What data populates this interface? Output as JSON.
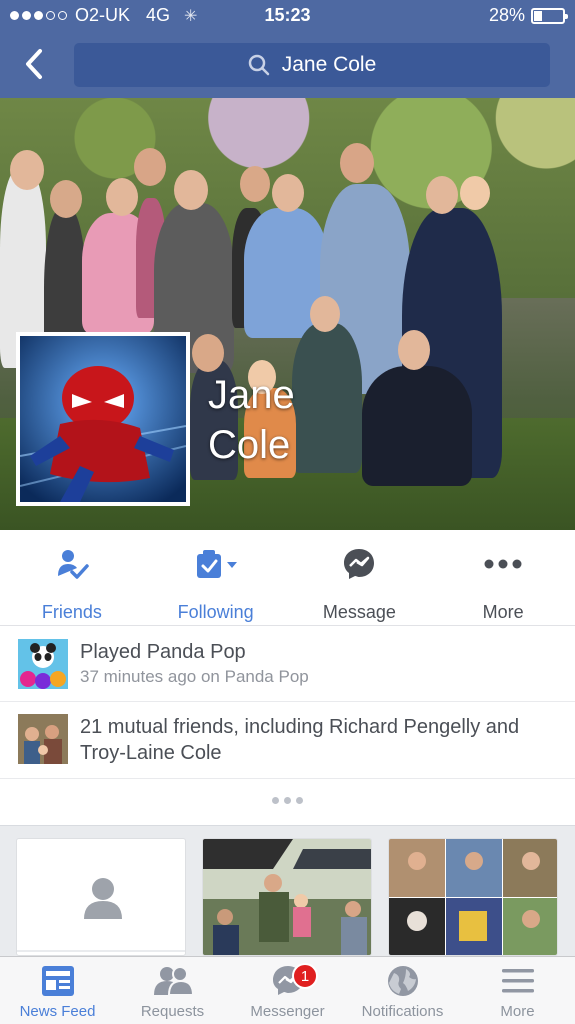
{
  "status_bar": {
    "carrier": "O2-UK",
    "network": "4G",
    "time": "15:23",
    "battery_percent": "28%",
    "battery_level": 0.28,
    "signal_bars": 3
  },
  "header": {
    "search_text": "Jane Cole"
  },
  "profile": {
    "name_line1": "Jane",
    "name_line2": "Cole"
  },
  "actions": [
    {
      "label": "Friends",
      "icon": "friends-check-icon",
      "color": "#4a7fd8"
    },
    {
      "label": "Following",
      "icon": "following-icon",
      "color": "#4a7fd8"
    },
    {
      "label": "Message",
      "icon": "messenger-icon",
      "color": "#4b4f56"
    },
    {
      "label": "More",
      "icon": "more-dots-icon",
      "color": "#4b4f56"
    }
  ],
  "info": {
    "activity_title": "Played Panda Pop",
    "activity_sub": "37 minutes ago on Panda Pop",
    "mutual_friends": "21 mutual friends, including Richard Pengelly and Troy-Laine Cole"
  },
  "tabs": [
    {
      "label": "News Feed",
      "icon": "news-feed-icon",
      "active": true
    },
    {
      "label": "Requests",
      "icon": "requests-icon"
    },
    {
      "label": "Messenger",
      "icon": "messenger-tab-icon",
      "badge": "1"
    },
    {
      "label": "Notifications",
      "icon": "globe-icon"
    },
    {
      "label": "More",
      "icon": "hamburger-icon"
    }
  ],
  "colors": {
    "header_bg": "#4e69a2",
    "accent": "#4a7fd8",
    "badge": "#e02020"
  }
}
